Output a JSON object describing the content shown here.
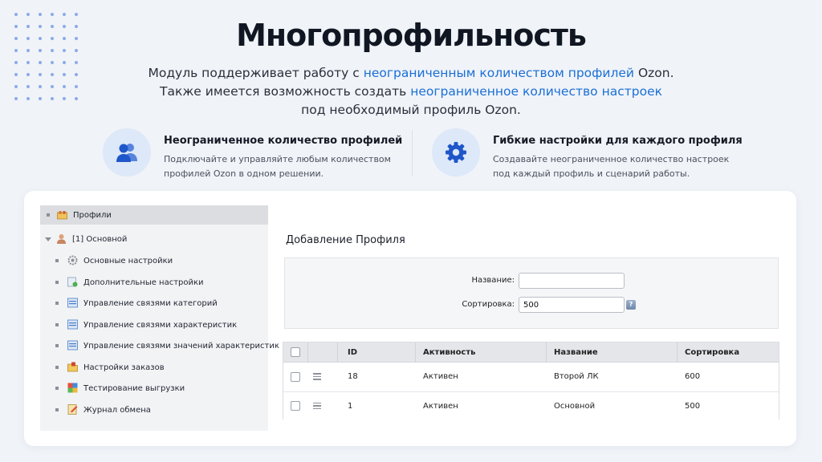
{
  "page": {
    "headline": "Многопрофильность",
    "subtitle": {
      "line1_a": "Модуль поддерживает работу с ",
      "line1_hl": "неограниченным количеством профилей",
      "line1_b": " Ozon.",
      "line2_a": "Также имеется возможность создать ",
      "line2_hl": "неограниченное количество настроек",
      "line3": "под необходимый профиль Ozon."
    },
    "accent_color": "#1a6fd6",
    "features": [
      {
        "icon": "users-icon",
        "title": "Неограниченное количество профилей",
        "desc": "Подключайте и управляйте любым количеством профилей Ozon в одном решении."
      },
      {
        "icon": "gear-icon",
        "title": "Гибкие настройки для каждого профиля",
        "desc": "Создавайте неограниченное количество настроек под каждый профиль и сценарий работы."
      }
    ]
  },
  "tree": {
    "root": {
      "label": "Профили",
      "icon": "profiles-folder-icon"
    },
    "profile": {
      "label": "[1] Основной",
      "icon": "user-icon"
    },
    "items": [
      {
        "label": "Основные настройки",
        "icon": "gear-icon"
      },
      {
        "label": "Дополнительные настройки",
        "icon": "add-settings-icon"
      },
      {
        "label": "Управление связями категорий",
        "icon": "list-icon"
      },
      {
        "label": "Управление связями характеристик",
        "icon": "list-icon"
      },
      {
        "label": "Управление связями значений характеристик",
        "icon": "list-icon"
      },
      {
        "label": "Настройки заказов",
        "icon": "orders-folder-icon"
      },
      {
        "label": "Тестирование выгрузки",
        "icon": "test-icon"
      },
      {
        "label": "Журнал обмена",
        "icon": "journal-icon"
      }
    ]
  },
  "form": {
    "title": "Добавление Профиля",
    "name_label": "Название:",
    "name_value": "",
    "sort_label": "Сортировка:",
    "sort_value": "500",
    "help": "?"
  },
  "table": {
    "columns": [
      "ID",
      "Активность",
      "Название",
      "Сортировка"
    ],
    "rows": [
      {
        "id": "18",
        "active": "Активен",
        "name": "Второй ЛК",
        "sort": "600"
      },
      {
        "id": "1",
        "active": "Активен",
        "name": "Основной",
        "sort": "500"
      }
    ]
  }
}
